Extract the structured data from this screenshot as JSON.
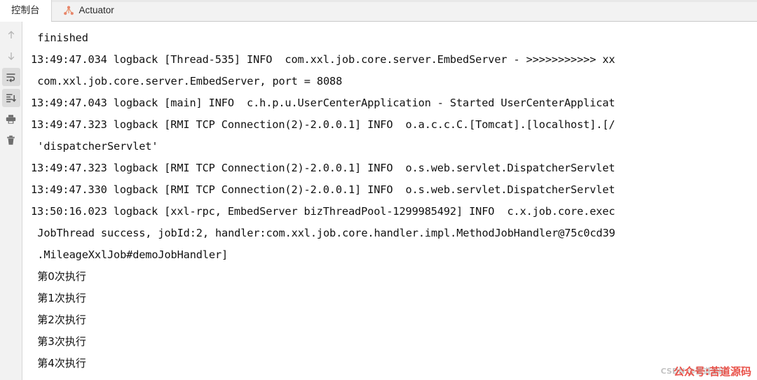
{
  "window": {
    "tabs": [
      {
        "label": "控制台",
        "icon": "",
        "selected": true
      },
      {
        "label": "Actuator",
        "icon": "actuator-graph-icon",
        "selected": false
      }
    ]
  },
  "toolbar": {
    "buttons": [
      {
        "name": "scroll-up-button",
        "icon": "arrow-up-icon",
        "active": false
      },
      {
        "name": "scroll-down-button",
        "icon": "arrow-down-icon",
        "active": false
      },
      {
        "name": "soft-wrap-button",
        "icon": "soft-wrap-icon",
        "active": true
      },
      {
        "name": "scroll-to-end-button",
        "icon": "scroll-to-end-icon",
        "active": true
      },
      {
        "name": "print-button",
        "icon": "printer-icon",
        "active": false
      },
      {
        "name": "clear-all-button",
        "icon": "trash-icon",
        "active": false
      }
    ]
  },
  "console": {
    "lines": [
      {
        "text": "finished",
        "indent": true,
        "cn": false
      },
      {
        "text": "13:49:47.034 logback [Thread-535] INFO  com.xxl.job.core.server.EmbedServer - >>>>>>>>>>> xx",
        "indent": false,
        "cn": false
      },
      {
        "text": "com.xxl.job.core.server.EmbedServer, port = 8088",
        "indent": true,
        "cn": false
      },
      {
        "text": "13:49:47.043 logback [main] INFO  c.h.p.u.UserCenterApplication - Started UserCenterApplicat",
        "indent": false,
        "cn": false
      },
      {
        "text": "13:49:47.323 logback [RMI TCP Connection(2)-2.0.0.1] INFO  o.a.c.c.C.[Tomcat].[localhost].[/",
        "indent": false,
        "cn": false
      },
      {
        "text": "'dispatcherServlet'",
        "indent": true,
        "cn": false
      },
      {
        "text": "13:49:47.323 logback [RMI TCP Connection(2)-2.0.0.1] INFO  o.s.web.servlet.DispatcherServlet",
        "indent": false,
        "cn": false
      },
      {
        "text": "13:49:47.330 logback [RMI TCP Connection(2)-2.0.0.1] INFO  o.s.web.servlet.DispatcherServlet",
        "indent": false,
        "cn": false
      },
      {
        "text": "13:50:16.023 logback [xxl-rpc, EmbedServer bizThreadPool-1299985492] INFO  c.x.job.core.exec",
        "indent": false,
        "cn": false
      },
      {
        "text": "JobThread success, jobId:2, handler:com.xxl.job.core.handler.impl.MethodJobHandler@75c0cd39",
        "indent": true,
        "cn": false
      },
      {
        "text": ".MileageXxlJob#demoJobHandler]",
        "indent": true,
        "cn": false
      },
      {
        "text": "第0次执行",
        "indent": true,
        "cn": true
      },
      {
        "text": "第1次执行",
        "indent": true,
        "cn": true
      },
      {
        "text": "第2次执行",
        "indent": true,
        "cn": true
      },
      {
        "text": "第3次执行",
        "indent": true,
        "cn": true
      },
      {
        "text": "第4次执行",
        "indent": true,
        "cn": true
      }
    ]
  },
  "watermarks": {
    "red_text": "公众号:苦道源码",
    "grey_text": "CSDN @苦道源码",
    "red_color": "#e8453c",
    "grey_color": "#b9b9b9"
  }
}
